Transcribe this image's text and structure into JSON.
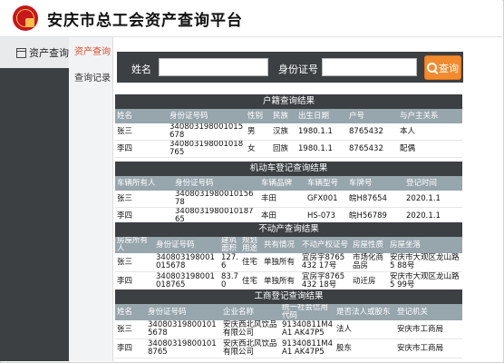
{
  "header": {
    "title": "安庆市总工会资产查询平台"
  },
  "nav": {
    "main_label": "资产查询",
    "sub_items": [
      {
        "label": "资产查询"
      },
      {
        "label": "查询记录"
      }
    ]
  },
  "search": {
    "name_label": "姓名",
    "name_value": "",
    "id_label": "身份证号",
    "id_value": "",
    "button_label": "查询"
  },
  "household": {
    "title": "户籍查询结果",
    "columns": [
      "姓名",
      "身份证号码",
      "性别",
      "民族",
      "出生日期",
      "户号",
      "与户主关系"
    ],
    "rows": [
      [
        "张三",
        "340803198001015678",
        "男",
        "汉族",
        "1980.1.1",
        "8765432",
        "本人"
      ],
      [
        "李四",
        "340803198001018765",
        "女",
        "回族",
        "1980.1.1",
        "8765432",
        "配偶"
      ]
    ]
  },
  "vehicle": {
    "title": "机动车登记查询结果",
    "columns": [
      "车辆所有人",
      "身份证号码",
      "车辆品牌",
      "车辆型号",
      "车牌号",
      "登记时间"
    ],
    "rows": [
      [
        "张三",
        "340803198001015678",
        "丰田",
        "GFX001",
        "皖H87654",
        "2020.1.1"
      ],
      [
        "李四",
        "340803198001018765",
        "本田",
        "HS-073",
        "皖H56789",
        "2020.1.1"
      ]
    ]
  },
  "property": {
    "title": "不动产查询结果",
    "columns": [
      "房屋所有人",
      "身份证号码",
      "建筑面积",
      "规划用途",
      "共有情况",
      "不动产权证号",
      "房屋性质",
      "房屋坐落"
    ],
    "rows": [
      [
        "张三",
        "340803198001015678",
        "127.6",
        "住宅",
        "单独所有",
        "宜房字8765432 17号",
        "市场化商品房",
        "安庆市大观区龙山路5 88号"
      ],
      [
        "李四",
        "340803198001018765",
        "83.70",
        "住宅",
        "单独所有",
        "宜房字8765432 18号",
        "动迁房",
        "安庆市大观区龙山路5 99号"
      ]
    ]
  },
  "business": {
    "title": "工商登记查询结果",
    "columns": [
      "姓名",
      "身份证号码",
      "企业名称",
      "统一社会信用代码",
      "是否法人或股东",
      "登记机关"
    ],
    "rows": [
      [
        "张三",
        "340803198001015678",
        "安庆西北风饮品有限公司",
        "91340811M4A1 AK47P5",
        "法人",
        "安庆市工商局"
      ],
      [
        "李四",
        "340803198001018765",
        "安庆西北风饮品有限公司",
        "91340811M4A1 AK47P5",
        "股东",
        "安庆市工商局"
      ]
    ]
  }
}
